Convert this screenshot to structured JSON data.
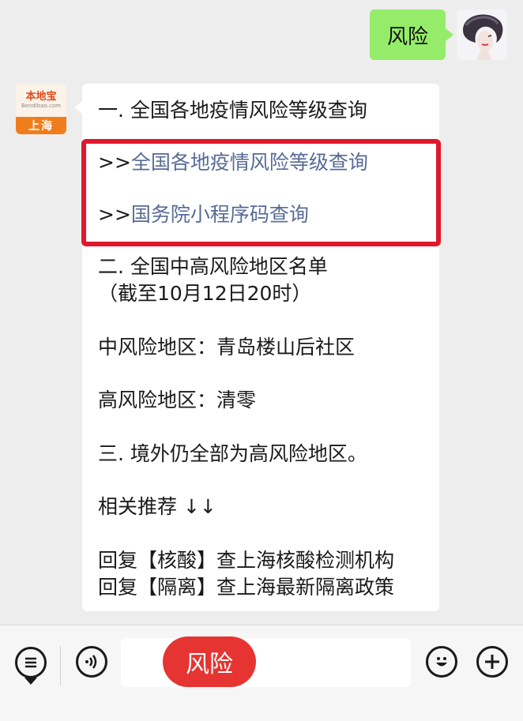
{
  "outgoing": {
    "text": "风险"
  },
  "bot": {
    "brand": "本地宝",
    "domain": "Bendibao.com",
    "city": "上海"
  },
  "message": {
    "line1": "一. 全国各地疫情风险等级查询",
    "link1_prefix": ">>",
    "link1": "全国各地疫情风险等级查询",
    "link2_prefix": ">>",
    "link2": "国务院小程序码查询",
    "line4": "二. 全国中高风险地区名单",
    "line5": "（截至10月12日20时）",
    "line6": "中风险地区：青岛楼山后社区",
    "line7": "高风险地区：清零",
    "line8": "三. 境外仍全部为高风险地区。",
    "line9": "相关推荐 ↓↓",
    "line10": "回复【核酸】查上海核酸检测机构",
    "line11": "回复【隔离】查上海最新隔离政策"
  },
  "input": {
    "overlay_label": "风险"
  },
  "icons": {
    "menu": "menu-list-icon",
    "voice": "voice-icon",
    "emoji": "emoji-icon",
    "plus": "plus-icon"
  },
  "colors": {
    "outgoing_bubble": "#95ec69",
    "link": "#576b95",
    "highlight": "#e0182c",
    "overlay": "#e53431"
  }
}
